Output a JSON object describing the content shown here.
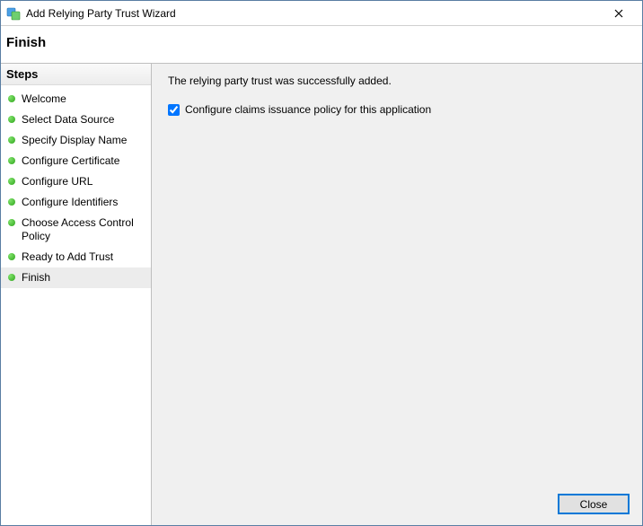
{
  "window": {
    "title": "Add Relying Party Trust Wizard"
  },
  "header": {
    "title": "Finish"
  },
  "sidebar": {
    "heading": "Steps",
    "items": [
      {
        "label": "Welcome"
      },
      {
        "label": "Select Data Source"
      },
      {
        "label": "Specify Display Name"
      },
      {
        "label": "Configure Certificate"
      },
      {
        "label": "Configure URL"
      },
      {
        "label": "Configure Identifiers"
      },
      {
        "label": "Choose Access Control Policy"
      },
      {
        "label": "Ready to Add Trust"
      },
      {
        "label": "Finish"
      }
    ],
    "activeIndex": 8
  },
  "content": {
    "message": "The relying party trust was successfully added.",
    "checkbox": {
      "label": "Configure claims issuance policy for this application",
      "checked": true
    }
  },
  "buttons": {
    "close": "Close"
  }
}
